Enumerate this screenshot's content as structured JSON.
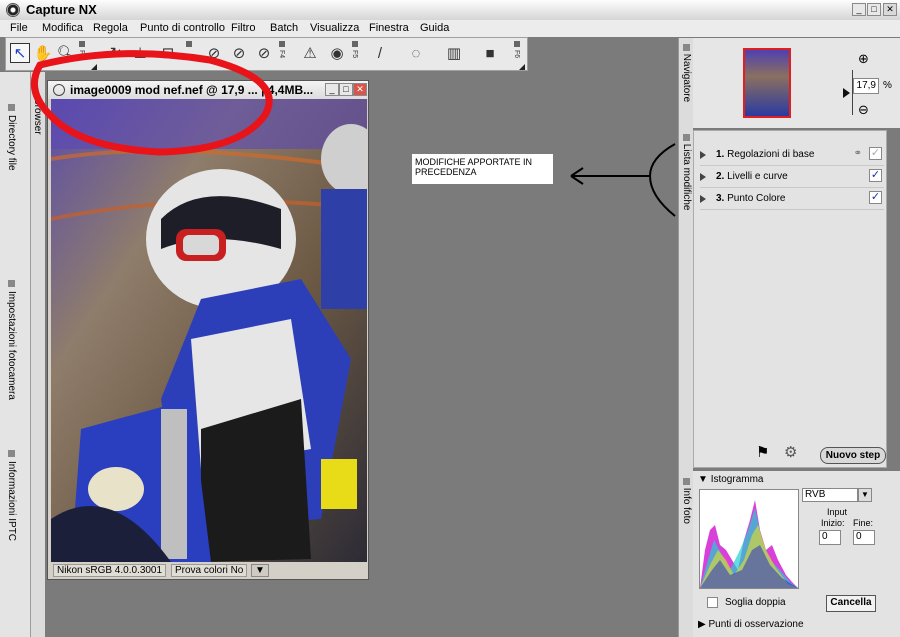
{
  "app": {
    "title": "Capture NX",
    "minimize": "_",
    "maximize": "□",
    "close": "✕"
  },
  "menu": [
    "File",
    "Modifica",
    "Regola",
    "Punto di controllo",
    "Filtro",
    "Batch",
    "Visualizza",
    "Finestra",
    "Guida"
  ],
  "toolbar": {
    "fkeys": [
      "F3",
      "F4",
      "F5",
      "F6"
    ]
  },
  "left_tabs": [
    "Directory file",
    "Impostazioni fotocamera",
    "Informazioni IPTC"
  ],
  "browser_tab": "Browser",
  "image_window": {
    "title": "image0009  mod  nef.nef @ 17,9 ... | 4,4MB...",
    "status_profile": "Nikon sRGB 4.0.0.3001",
    "status_proof": "Prova colori No"
  },
  "annotation": {
    "text": "MODIFICHE APPORTATE IN PRECEDENZA",
    "highlight_color": "#e8141a"
  },
  "right_tabs": [
    "Navigatore",
    "Lista modifiche",
    "Info foto"
  ],
  "navigator": {
    "zoom": "17,9",
    "unit": "%"
  },
  "edit_list": {
    "steps": [
      {
        "num": "1.",
        "label": "Regolazioni di base",
        "checked": true
      },
      {
        "num": "2.",
        "label": "Livelli e curve",
        "checked": true
      },
      {
        "num": "3.",
        "label": "Punto Colore",
        "checked": true
      }
    ],
    "new_step": "Nuovo step"
  },
  "histogram": {
    "title": "Istogramma",
    "channel": "RVB",
    "input_label": "Input",
    "start_label": "Inizio:",
    "end_label": "Fine:",
    "start_value": "0",
    "end_value": "0",
    "double_threshold": "Soglia doppia",
    "cancel": "Cancella",
    "watch_points": "Punti di osservazione"
  }
}
